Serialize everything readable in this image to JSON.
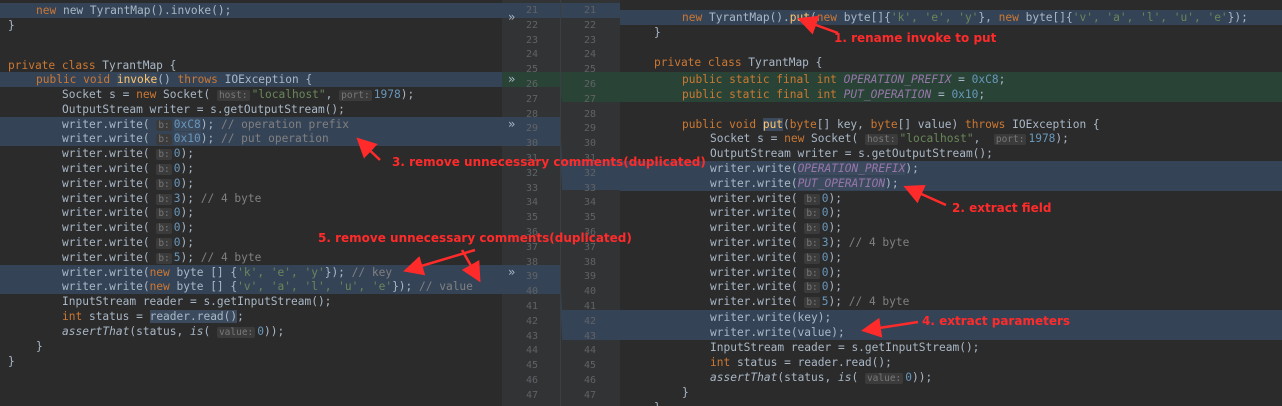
{
  "left": {
    "l0": "new TyrantMap().invoke();",
    "l1": "}",
    "l3_kw": "private class ",
    "l3_name": "TyrantMap {",
    "l4_kw": "public void ",
    "l4_fn": "invoke",
    "l4_rest": "() ",
    "l4_kw2": "throws ",
    "l4_exc": "IOException {",
    "l5_a": "Socket s = ",
    "l5_kw": "new ",
    "l5_b": "Socket(",
    "l5_h1": "host:",
    "l5_s": "\"localhost\"",
    "l5_c": ", ",
    "l5_h2": "port:",
    "l5_n": "1978",
    "l5_d": ");",
    "l6": "OutputStream writer = s.getOutputStream();",
    "w_pre": "writer.write(",
    "w_hint": "b:",
    "w_post": ");",
    "l7_n": "0xC8",
    "l7_c": "// operation prefix",
    "l8_n": "0x10",
    "l8_c": "// put operation",
    "zero": "0",
    "three": "3",
    "five": "5",
    "c4": "// 4 byte",
    "l19_kw": "new ",
    "l19_a": "byte [] {",
    "l19_s": "'k', 'e', 'y'",
    "l19_b": "}); ",
    "l19_c": "// key",
    "l20_s": "'v', 'a', 'l', 'u', 'e'",
    "l20_c": "// value",
    "l21": "InputStream reader = s.getInputStream();",
    "l22_kw": "int ",
    "l22_a": "status = ",
    "l22_b": "reader.read()",
    "l22_c": ";",
    "l23_fn": "assertThat",
    "l23_a": "(status, ",
    "l23_is": "is",
    "l23_b": "( ",
    "l23_h": "value:",
    "l23_n": "0",
    "l23_c": "));",
    "close": "}"
  },
  "gutter": {
    "left_nums": [
      "21",
      "22",
      "23",
      "24",
      "25",
      "26",
      "27",
      "28",
      "29",
      "30",
      "31",
      "32",
      "33",
      "34",
      "35",
      "36",
      "37",
      "38",
      "39",
      "40",
      "41",
      "42",
      "43",
      "44",
      "45",
      "46",
      "47"
    ],
    "right_nums": [
      "21",
      "22",
      "23",
      "24",
      "25",
      "26",
      "27",
      "28",
      "29",
      "30",
      "31",
      "32",
      "33",
      "34",
      "35",
      "36",
      "37",
      "38",
      "39",
      "40",
      "41",
      "42",
      "43",
      "44",
      "45",
      "46",
      "47"
    ],
    "arrow": "»"
  },
  "right": {
    "r0_a": "new ",
    "r0_b": "TyrantMap().",
    "r0_fn": "put",
    "r0_c": "(",
    "r0_kw": "new ",
    "r0_d": "byte[]{",
    "r0_s1": "'k', 'e', 'y'",
    "r0_e": "}, ",
    "r0_kw2": "new ",
    "r0_f": "byte[]{",
    "r0_s2": "'v', 'a', 'l', 'u', 'e'",
    "r0_g": "});",
    "r1": "}",
    "r3_kw": "private class ",
    "r3_name": "TyrantMap {",
    "r4_kw": "public static final int ",
    "r4_c": "OPERATION_PREFIX",
    "r4_eq": " = ",
    "r4_n": "0xC8",
    "r4_e": ";",
    "r5_c": "PUT_OPERATION",
    "r5_n": "0x10",
    "r7_kw": "public void ",
    "r7_fn": "put",
    "r7_a": "(",
    "r7_kw2": "byte",
    "r7_b": "[] key, ",
    "r7_kw3": "byte",
    "r7_c": "[] value) ",
    "r7_kw4": "throws ",
    "r7_d": "IOException {",
    "r8_a": "Socket s = ",
    "r8_kw": "new ",
    "r8_b": "Socket( ",
    "r8_h1": "host:",
    "r8_s": "\"localhost\"",
    "r8_c": ",  ",
    "r8_h2": "port:",
    "r8_n": "1978",
    "r8_d": ");",
    "r9": "OutputStream writer = s.getOutputStream();",
    "w_pre": "writer.write(",
    "w_post": ");",
    "r18": "writer.write(key);",
    "r19": "writer.write(value);",
    "r20": "InputStream reader = s.getInputStream();",
    "r21_kw": "int ",
    "r21_a": "status = reader.read();",
    "r22_fn": "assertThat",
    "r22_a": "(status, ",
    "r22_is": "is",
    "r22_b": "( ",
    "r22_h": "value:",
    "r22_n": "0",
    "r22_c": "));",
    "r23": "}",
    "r24": "}"
  },
  "annotations": {
    "a1": "1. rename invoke to put",
    "a2": "2. extract field",
    "a3": "3. remove unnecessary comments(duplicated)",
    "a4": "4. extract parameters",
    "a5": "5. remove unnecessary comments(duplicated)"
  },
  "colors": {
    "annotation": "#ff2b2b",
    "changed_block": "#354357",
    "inserted_block": "#294436"
  }
}
